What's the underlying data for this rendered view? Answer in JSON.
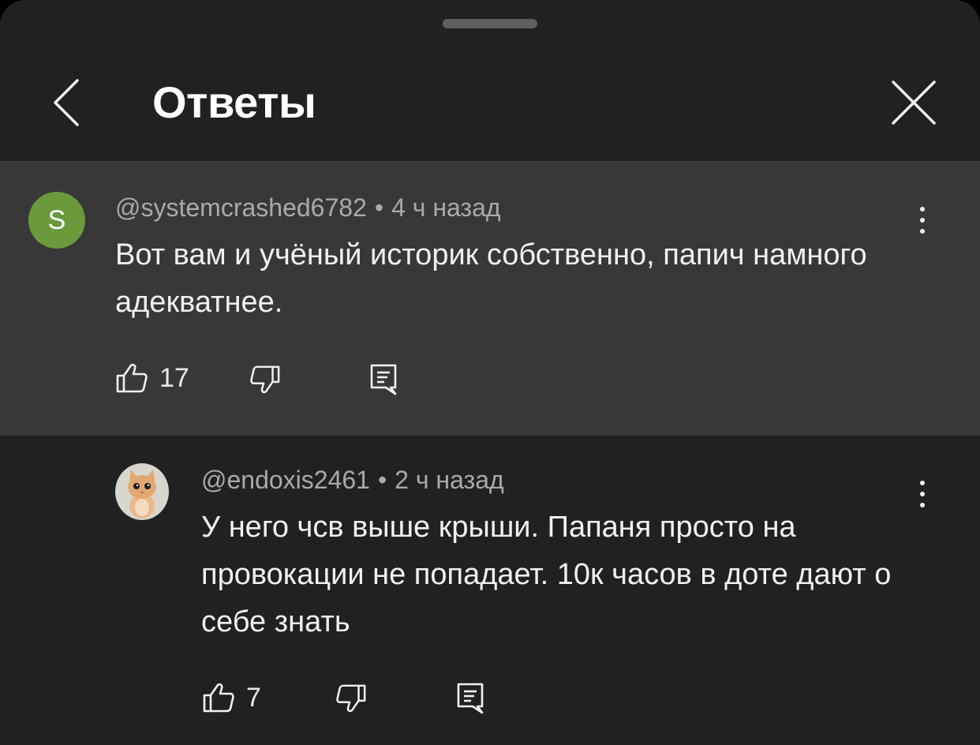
{
  "header": {
    "title": "Ответы",
    "back_icon": "chevron-left-icon",
    "close_icon": "close-icon"
  },
  "parent_comment": {
    "avatar_letter": "S",
    "avatar_color": "#6a9a3c",
    "author": "@systemcrashed6782",
    "separator": "•",
    "time": "4 ч назад",
    "text": "Вот вам и учёный историк собственно, папич намного адекватнее.",
    "likes": "17"
  },
  "reply": {
    "author": "@endoxis2461",
    "separator": "•",
    "time": "2 ч назад",
    "text": "У него чсв выше крыши. Папаня просто на провокации не попадает. 10к часов в доте дают о себе знать",
    "likes": "7"
  },
  "colors": {
    "sheet_bg": "#212121",
    "highlight_bg": "#383838",
    "text_primary": "#f1f1f1",
    "text_secondary": "#aaaaaa"
  }
}
